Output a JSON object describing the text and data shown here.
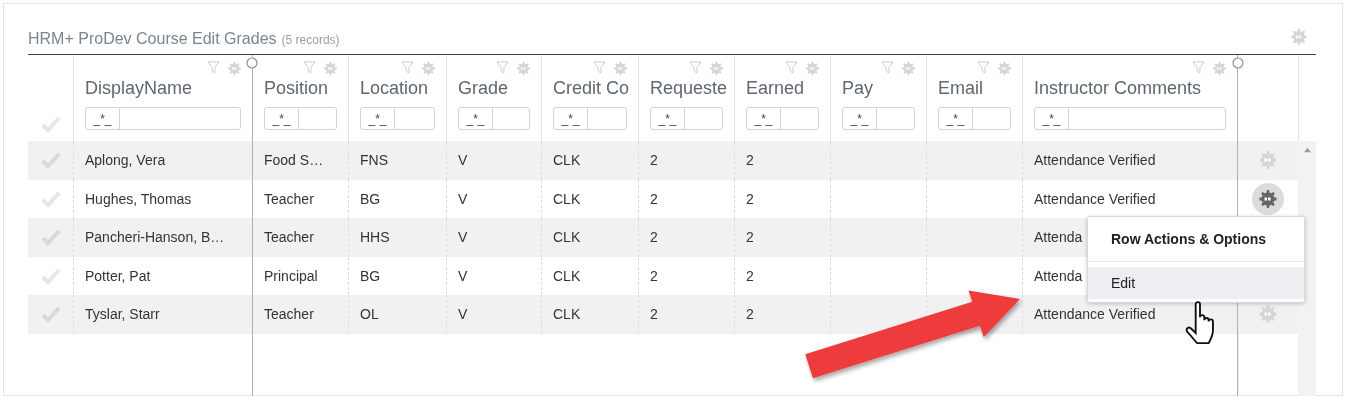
{
  "panel": {
    "title": "HRM+ ProDev Course Edit Grades",
    "record_count": "(5 records)"
  },
  "table": {
    "columns": [
      {
        "label": "DisplayName",
        "operator": "_*_"
      },
      {
        "label": "Position",
        "operator": "_*_"
      },
      {
        "label": "Location",
        "operator": "_*_"
      },
      {
        "label": "Grade",
        "operator": "_*_"
      },
      {
        "label": "Credit Co",
        "operator": "_*_"
      },
      {
        "label": "Requeste",
        "operator": "_*_"
      },
      {
        "label": "Earned",
        "operator": "_*_"
      },
      {
        "label": "Pay",
        "operator": "_*_"
      },
      {
        "label": "Email",
        "operator": "_*_"
      },
      {
        "label": "Instructor Comments",
        "operator": "_*_"
      }
    ],
    "rows": [
      {
        "selected": false,
        "actions_active": false,
        "cells": [
          "Aplong, Vera",
          "Food S…",
          "FNS",
          "V",
          "CLK",
          "2",
          "2",
          "",
          "",
          "Attendance Verified"
        ]
      },
      {
        "selected": false,
        "actions_active": true,
        "cells": [
          "Hughes, Thomas",
          "Teacher",
          "BG",
          "V",
          "CLK",
          "2",
          "2",
          "",
          "",
          "Attendance Verified"
        ]
      },
      {
        "selected": false,
        "cells": [
          "Pancheri-Hanson, B…",
          "Teacher",
          "HHS",
          "V",
          "CLK",
          "2",
          "2",
          "",
          "",
          "Attenda"
        ]
      },
      {
        "selected": false,
        "cells": [
          "Potter, Pat",
          "Principal",
          "BG",
          "V",
          "CLK",
          "2",
          "2",
          "",
          "",
          "Attenda"
        ]
      },
      {
        "selected": false,
        "actions_active": false,
        "cells": [
          "Tyslar, Starr",
          "Teacher",
          "OL",
          "V",
          "CLK",
          "2",
          "2",
          "",
          "",
          "Attendance Verified"
        ]
      }
    ]
  },
  "row_menu": {
    "title": "Row Actions & Options",
    "items": [
      {
        "label": "Edit",
        "selected": true
      }
    ]
  }
}
